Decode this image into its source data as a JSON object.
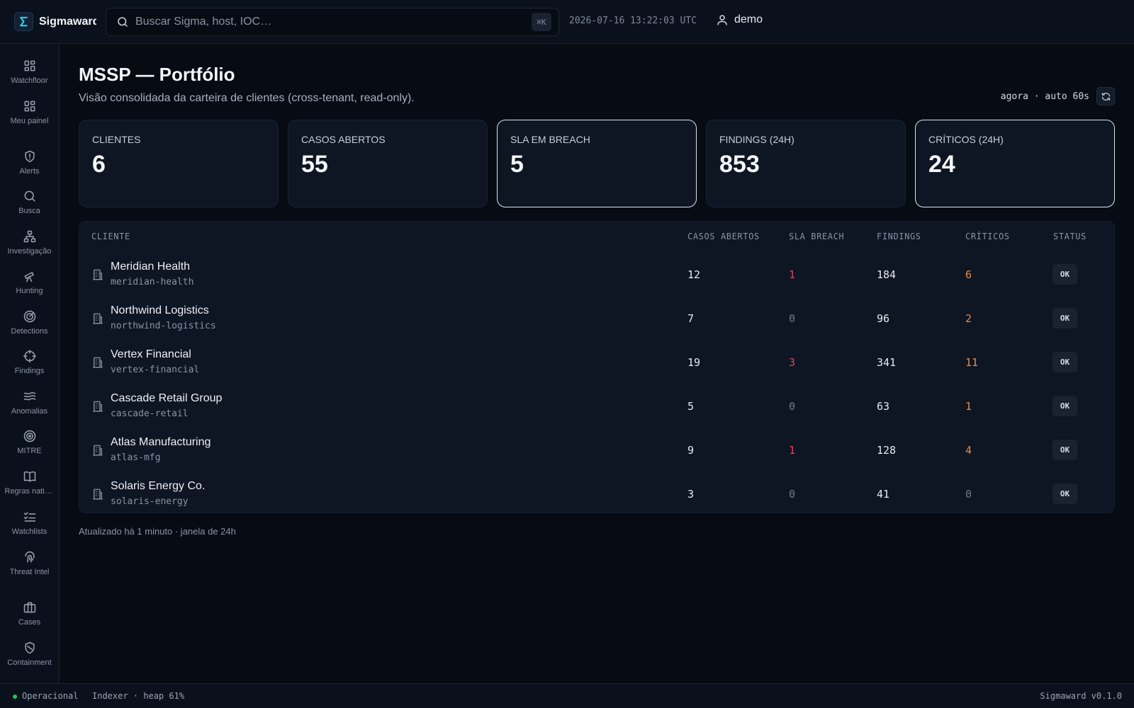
{
  "header": {
    "brand": "Sigmaward",
    "search_placeholder": "Buscar Sigma, host, IOC…",
    "shortcut": "⌘K",
    "clock": "2026-07-16 13:22:03 UTC",
    "user": "demo"
  },
  "sidebar": {
    "items": [
      {
        "label": "Watchfloor",
        "icon": "grid-icon"
      },
      {
        "label": "Meu painel",
        "icon": "grid-icon"
      },
      {
        "label": "Alerts",
        "icon": "shield-alert-icon"
      },
      {
        "label": "Busca",
        "icon": "search-icon"
      },
      {
        "label": "Investigação",
        "icon": "network-icon"
      },
      {
        "label": "Hunting",
        "icon": "telescope-icon"
      },
      {
        "label": "Detections",
        "icon": "radar-icon"
      },
      {
        "label": "Findings",
        "icon": "crosshair-icon"
      },
      {
        "label": "Anomalias",
        "icon": "waves-icon"
      },
      {
        "label": "MITRE",
        "icon": "target-icon"
      },
      {
        "label": "Regras nativas",
        "icon": "book-icon"
      },
      {
        "label": "Watchlists",
        "icon": "list-check-icon"
      },
      {
        "label": "Threat Intel",
        "icon": "fingerprint-icon"
      },
      {
        "label": "Cases",
        "icon": "briefcase-icon"
      },
      {
        "label": "Containment",
        "icon": "shield-off-icon"
      }
    ]
  },
  "page": {
    "title": "MSSP — Portfólio",
    "subtitle": "Visão consolidada da carteira de clientes (cross-tenant, read-only).",
    "refresh_text": "agora · auto 60s",
    "footnote": "Atualizado há 1 minuto · janela de 24h"
  },
  "stats": [
    {
      "label": "CLIENTES",
      "value": "6"
    },
    {
      "label": "CASOS ABERTOS",
      "value": "55"
    },
    {
      "label": "SLA EM BREACH",
      "value": "5"
    },
    {
      "label": "FINDINGS (24H)",
      "value": "853"
    },
    {
      "label": "CRÍTICOS (24H)",
      "value": "24"
    }
  ],
  "table": {
    "headers": {
      "client": "CLIENTE",
      "cases": "CASOS ABERTOS",
      "sla": "SLA BREACH",
      "findings": "FINDINGS",
      "critical": "CRÍTICOS",
      "status": "STATUS"
    },
    "rows": [
      {
        "name": "Meridian Health",
        "slug": "meridian-health",
        "cases": "12",
        "sla": "1",
        "findings": "184",
        "critical": "6",
        "status": "OK"
      },
      {
        "name": "Northwind Logistics",
        "slug": "northwind-logistics",
        "cases": "7",
        "sla": "0",
        "findings": "96",
        "critical": "2",
        "status": "OK"
      },
      {
        "name": "Vertex Financial",
        "slug": "vertex-financial",
        "cases": "19",
        "sla": "3",
        "findings": "341",
        "critical": "11",
        "status": "OK"
      },
      {
        "name": "Cascade Retail Group",
        "slug": "cascade-retail",
        "cases": "5",
        "sla": "0",
        "findings": "63",
        "critical": "1",
        "status": "OK"
      },
      {
        "name": "Atlas Manufacturing",
        "slug": "atlas-mfg",
        "cases": "9",
        "sla": "1",
        "findings": "128",
        "critical": "4",
        "status": "OK"
      },
      {
        "name": "Solaris Energy Co.",
        "slug": "solaris-energy",
        "cases": "3",
        "sla": "0",
        "findings": "41",
        "critical": "0",
        "status": "OK"
      }
    ]
  },
  "statusbar": {
    "state": "Operacional",
    "indexer": "Indexer · heap 61%",
    "version": "Sigmaward v0.1.0"
  },
  "colors": {
    "accent": "#22d3ee",
    "sla_breach": "#ef3f55",
    "critical": "#f08a3a",
    "operational": "#22c55e"
  }
}
